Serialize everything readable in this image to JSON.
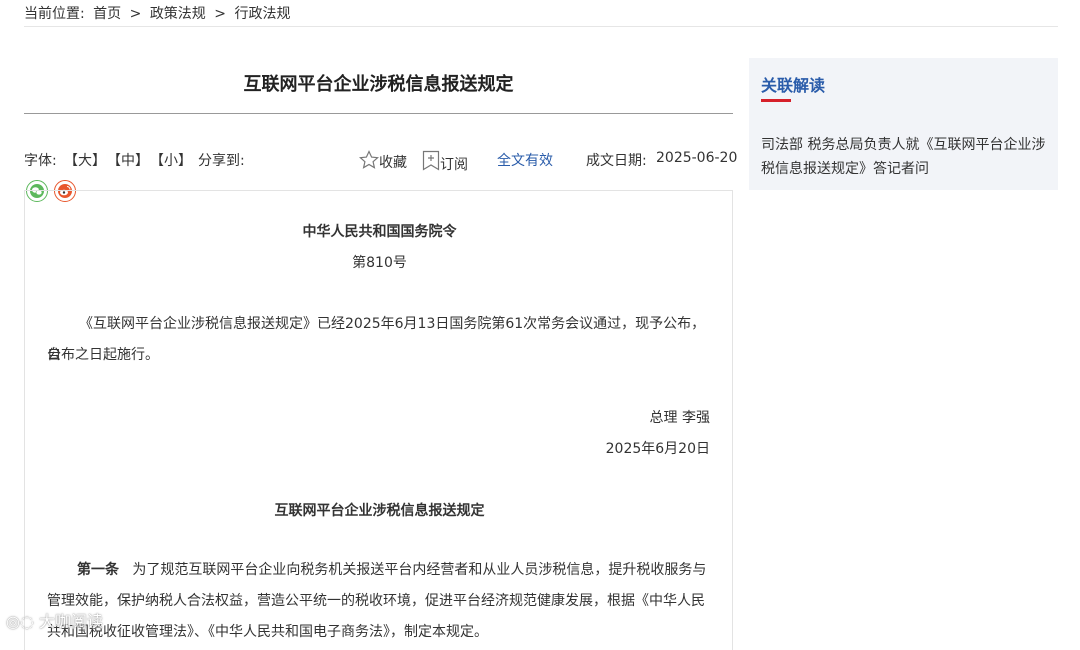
{
  "breadcrumb": {
    "prefix": "当前位置:",
    "items": [
      "首页",
      ">",
      "政策法规",
      ">",
      "行政法规"
    ]
  },
  "article": {
    "title": "互联网平台企业涉税信息报送规定"
  },
  "toolbar": {
    "font_label": "字体:",
    "size_large": "【大】",
    "size_medium": "【中】",
    "size_small": "【小】",
    "share_label": "分享到:",
    "favorite": "收藏",
    "subscribe": "订阅",
    "validity": "全文有效",
    "date_label": "成文日期:",
    "date_value": "2025-06-20"
  },
  "share": {
    "icons": [
      "wechat-icon",
      "weibo-icon"
    ],
    "colors": {
      "wechat": "#5cb85c",
      "weibo": "#e8572d"
    }
  },
  "content": {
    "issuer": "中华人民共和国国务院令",
    "number": "第810号",
    "preamble_line1": "《互联网平台企业涉税信息报送规定》已经2025年6月13日国务院第61次常务会议通过，现予公布，自",
    "preamble_line2": "公布之日起施行。",
    "signer": "总理 李强",
    "sign_date": "2025年6月20日",
    "rule_title": "互联网平台企业涉税信息报送规定",
    "article1_label": "第一条",
    "article1_line1": "为了规范互联网平台企业向税务机关报送平台内经营者和从业人员涉税信息，提升税收服务与",
    "article1_line2": "管理效能，保护纳税人合法权益，营造公平统一的税收环境，促进平台经济规范健康发展，根据《中华人民",
    "article1_line3": "共和国税收征收管理法》、《中华人民共和国电子商务法》，制定本规定。"
  },
  "sidebar": {
    "title": "关联解读",
    "link_text": "司法部 税务总局负责人就《互联网平台企业涉税信息报送规定》答记者问",
    "accent_color": "#d6202a"
  },
  "watermark": {
    "text": "大咖阅读"
  }
}
